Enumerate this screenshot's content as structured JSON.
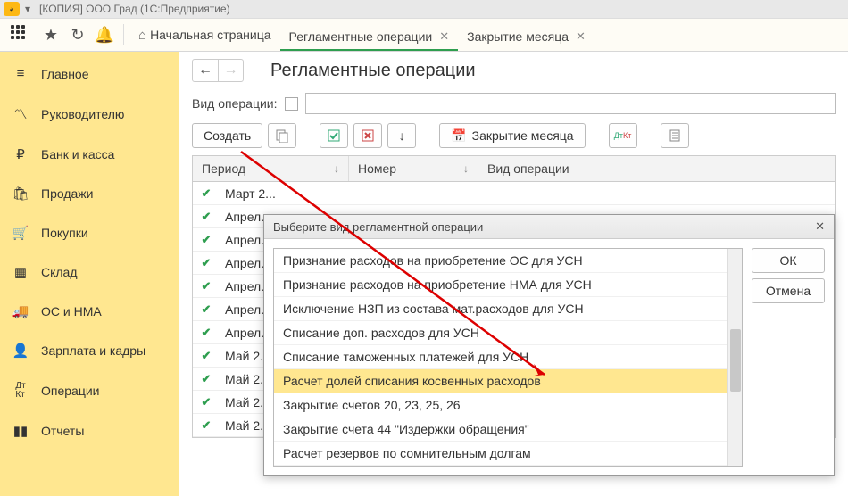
{
  "window_title": "[КОПИЯ] ООО Град  (1С:Предприятие)",
  "home_label": "Начальная страница",
  "tabs": [
    {
      "label": "Регламентные операции",
      "active": true
    },
    {
      "label": "Закрытие месяца",
      "active": false
    }
  ],
  "sidebar": {
    "items": [
      {
        "icon": "menu",
        "label": "Главное"
      },
      {
        "icon": "trend",
        "label": "Руководителю"
      },
      {
        "icon": "ruble",
        "label": "Банк и касса"
      },
      {
        "icon": "bag",
        "label": "Продажи"
      },
      {
        "icon": "cart",
        "label": "Покупки"
      },
      {
        "icon": "boxes",
        "label": "Склад"
      },
      {
        "icon": "truck",
        "label": "ОС и НМА"
      },
      {
        "icon": "person",
        "label": "Зарплата и кадры"
      },
      {
        "icon": "dtkt",
        "label": "Операции"
      },
      {
        "icon": "bars",
        "label": "Отчеты"
      }
    ]
  },
  "page_title": "Регламентные операции",
  "filter_label": "Вид операции:",
  "toolbar": {
    "create": "Создать",
    "close_month": "Закрытие месяца"
  },
  "grid": {
    "columns": [
      {
        "label": "Период",
        "sortable": true
      },
      {
        "label": "Номер",
        "sortable": true
      },
      {
        "label": "Вид операции",
        "sortable": false
      }
    ],
    "rows": [
      {
        "period": "Март 2..."
      },
      {
        "period": "Апрел..."
      },
      {
        "period": "Апрел..."
      },
      {
        "period": "Апрел..."
      },
      {
        "period": "Апрел..."
      },
      {
        "period": "Апрел..."
      },
      {
        "period": "Апрел..."
      },
      {
        "period": "Май 2..."
      },
      {
        "period": "Май 2..."
      },
      {
        "period": "Май 2..."
      },
      {
        "period": "Май 2..."
      }
    ]
  },
  "dialog": {
    "title": "Выберите вид регламентной операции",
    "ok": "ОК",
    "cancel": "Отмена",
    "items": [
      "Признание расходов на приобретение ОС для УСН",
      "Признание расходов на приобретение НМА для УСН",
      "Исключение НЗП из состава мат.расходов для УСН",
      "Списание доп. расходов для УСН",
      "Списание таможенных платежей для УСН",
      "Расчет долей списания косвенных расходов",
      "Закрытие счетов 20, 23, 25, 26",
      "Закрытие счета 44 \"Издержки обращения\"",
      "Расчет резервов по сомнительным долгам"
    ],
    "selected_index": 5
  }
}
